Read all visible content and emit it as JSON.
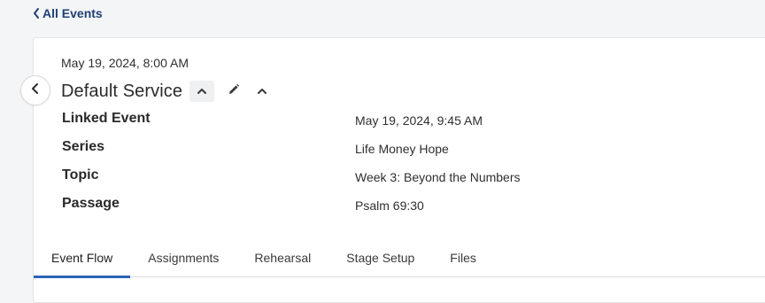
{
  "nav": {
    "back_label": "All Events"
  },
  "event": {
    "datetime": "May 19, 2024, 8:00 AM",
    "title": "Default Service"
  },
  "details": [
    {
      "label": "Linked Event",
      "value": "May 19, 2024, 9:45 AM"
    },
    {
      "label": "Series",
      "value": "Life Money Hope"
    },
    {
      "label": "Topic",
      "value": "Week 3: Beyond the Numbers"
    },
    {
      "label": "Passage",
      "value": "Psalm 69:30"
    }
  ],
  "tabs": [
    {
      "label": "Event Flow",
      "active": true
    },
    {
      "label": "Assignments",
      "active": false
    },
    {
      "label": "Rehearsal",
      "active": false
    },
    {
      "label": "Stage Setup",
      "active": false
    },
    {
      "label": "Files",
      "active": false
    }
  ],
  "icons": {
    "back": "chevron-left-icon",
    "previous": "chevron-left-icon",
    "toggle": "chevron-up-icon",
    "edit": "pencil-icon",
    "collapse": "chevron-up-icon"
  },
  "colors": {
    "link": "#1f3f73",
    "accent": "#2d64b8",
    "page_bg": "#f4f5f6",
    "card_bg": "#ffffff"
  }
}
